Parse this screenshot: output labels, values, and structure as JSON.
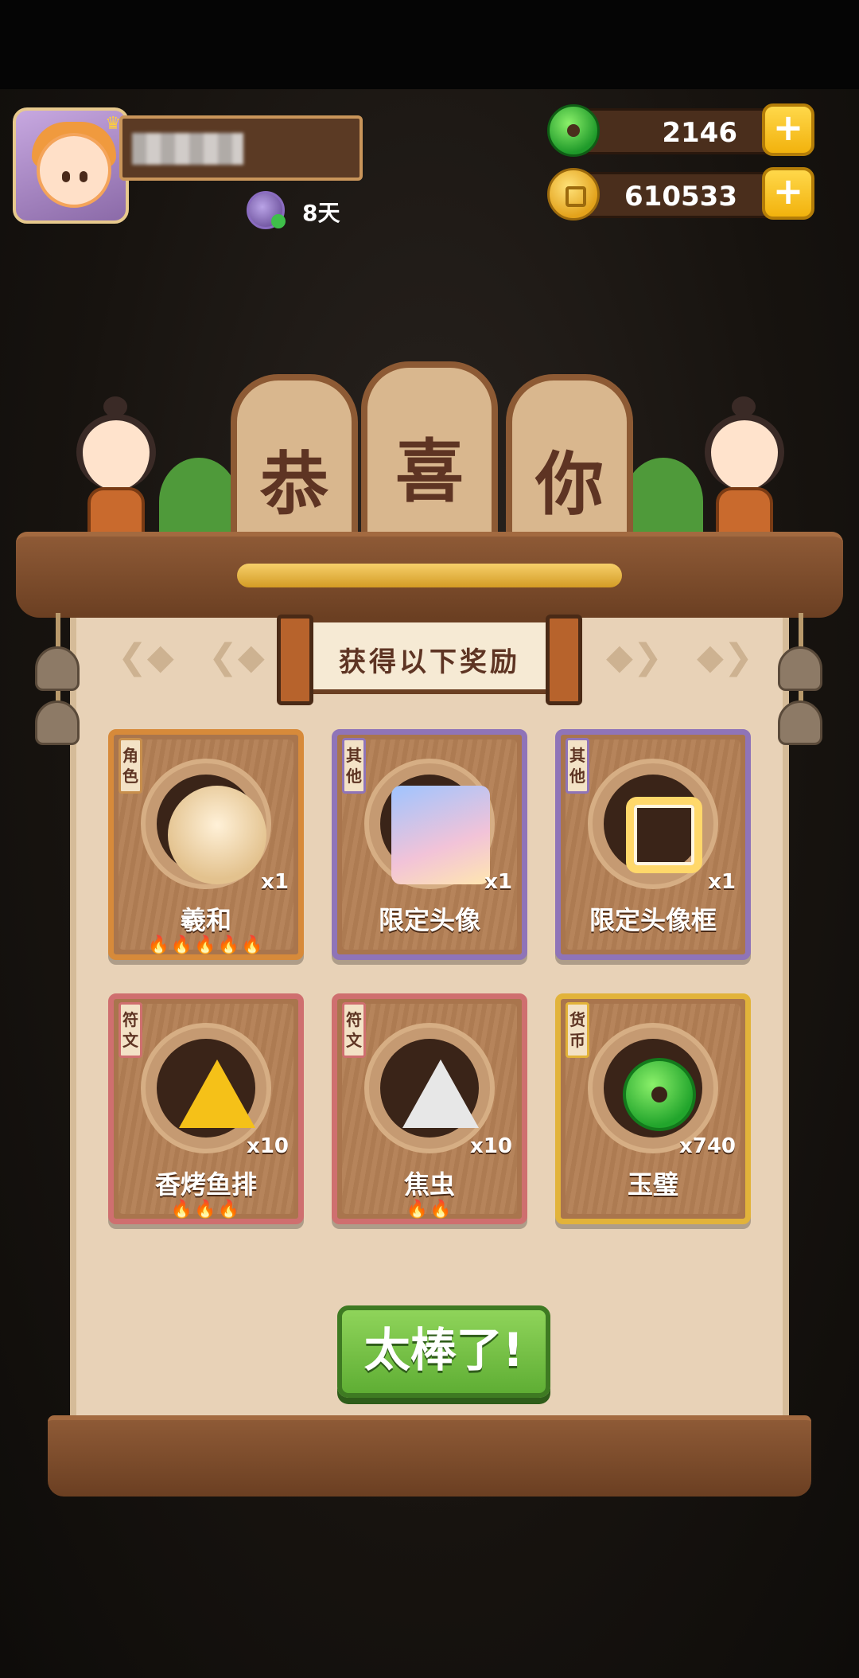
{
  "header": {
    "days_label": "8天",
    "currencies": [
      {
        "name": "jade",
        "value": "2146",
        "icon": "jade-icon"
      },
      {
        "name": "coin",
        "value": "610533",
        "icon": "coin-icon"
      }
    ]
  },
  "banner": {
    "chars": [
      "恭",
      "喜",
      "你"
    ]
  },
  "reward_title": "获得以下奖励",
  "rewards": [
    {
      "tag": "角色",
      "name": "羲和",
      "qty": "x1",
      "flames": "🔥🔥🔥🔥🔥",
      "color": "#d78a3a"
    },
    {
      "tag": "其他",
      "name": "限定头像",
      "qty": "x1",
      "flames": "",
      "color": "#8f74b8"
    },
    {
      "tag": "其他",
      "name": "限定头像框",
      "qty": "x1",
      "flames": "",
      "color": "#8f74b8"
    },
    {
      "tag": "符文",
      "name": "香烤鱼排",
      "qty": "x10",
      "flames": "🔥🔥🔥",
      "color": "#cf6f6f"
    },
    {
      "tag": "符文",
      "name": "焦虫",
      "qty": "x10",
      "flames": "🔥🔥",
      "color": "#cf6f6f"
    },
    {
      "tag": "货币",
      "name": "玉璧",
      "qty": "x740",
      "flames": "",
      "color": "#e2b33a"
    }
  ],
  "confirm_button": "太棒了!"
}
